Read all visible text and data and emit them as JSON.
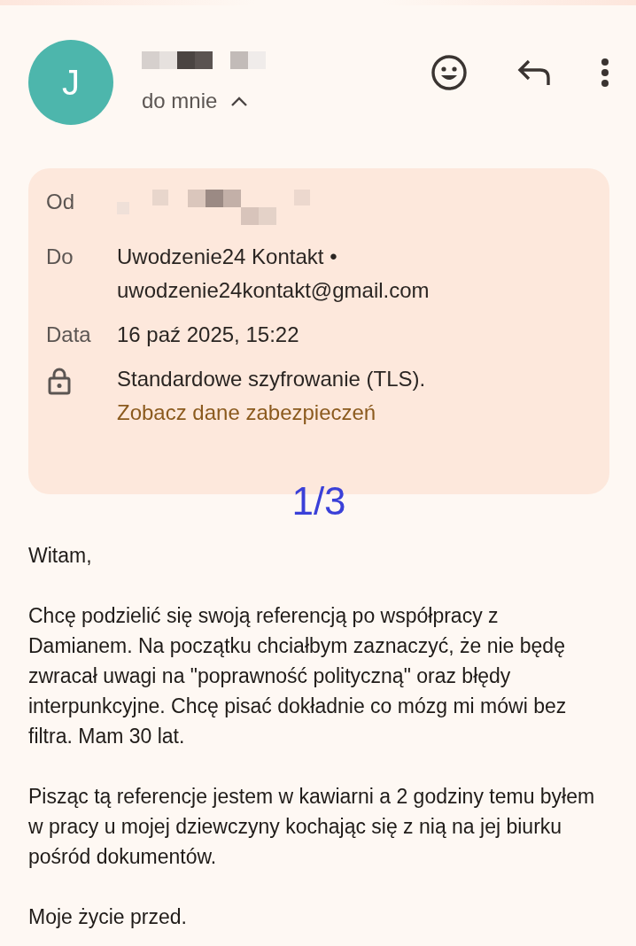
{
  "header": {
    "avatar_letter": "J",
    "recipient_label": "do mnie",
    "details_expanded": true
  },
  "details": {
    "from_label": "Od",
    "to_label": "Do",
    "to_name": "Uwodzenie24 Kontakt •",
    "to_email": "uwodzenie24kontakt@gmail.com",
    "date_label": "Data",
    "date": "16 paź 2025, 15:22",
    "encryption": "Standardowe szyfrowanie (TLS).",
    "security_link": "Zobacz dane zabezpieczeń"
  },
  "page_marker": "1/3",
  "body": [
    "Witam,",
    "Chcę podzielić się swoją referencją po współpracy z Damianem. Na początku chciałbym zaznaczyć, że nie będę zwracał uwagi na \"poprawność polityczną\" oraz błędy interpunkcyjne. Chcę pisać dokładnie co mózg mi mówi bez filtra. Mam 30 lat.",
    "Pisząc tą referencje jestem w kawiarni a 2 godziny temu byłem w pracy u mojej dziewczyny kochając się z nią na jej biurku pośród dokumentów.",
    "Moje życie przed."
  ]
}
